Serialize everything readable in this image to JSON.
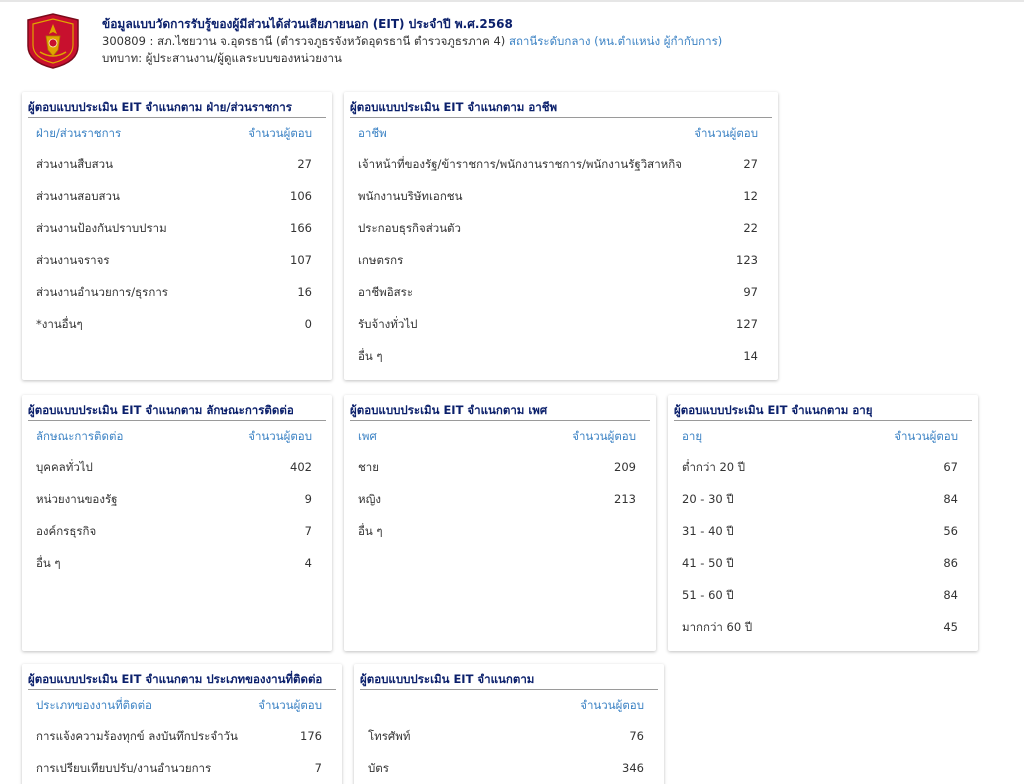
{
  "header": {
    "title": "ข้อมูลแบบวัดการรับรู้ของผู้มีส่วนได้ส่วนเสียภายนอก (EIT) ประจำปี พ.ศ.2568",
    "unit": "300809 : สภ.ไชยวาน จ.อุดรธานี (ตำรวจภูธรจังหวัดอุดรธานี ตำรวจภูธรภาค 4)",
    "unit_level": "สถานีระดับกลาง (หน.ตำแหน่ง ผู้กำกับการ)",
    "role": "บทบาท: ผู้ประสานงาน/ผู้ดูแลระบบของหน่วยงาน"
  },
  "colors": {
    "title": "#0a1f6b",
    "accent": "#3b82c4",
    "logo_red": "#c8102e",
    "logo_gold": "#e0a400"
  },
  "cards": {
    "division": {
      "title": "ผู้ตอบแบบประเมิน EIT จำแนกตาม ฝ่าย/ส่วนราชการ",
      "col_label": "ฝ่าย/ส่วนราชการ",
      "col_value": "จำนวนผู้ตอบ",
      "rows": [
        {
          "label": "ส่วนงานสืบสวน",
          "value": "27"
        },
        {
          "label": "ส่วนงานสอบสวน",
          "value": "106"
        },
        {
          "label": "ส่วนงานป้องกันปราบปราม",
          "value": "166"
        },
        {
          "label": "ส่วนงานจราจร",
          "value": "107"
        },
        {
          "label": "ส่วนงานอำนวยการ/ธุรการ",
          "value": "16"
        },
        {
          "label": "*งานอื่นๆ",
          "value": "0"
        }
      ]
    },
    "occupation": {
      "title": "ผู้ตอบแบบประเมิน EIT จำแนกตาม อาชีพ",
      "col_label": "อาชีพ",
      "col_value": "จำนวนผู้ตอบ",
      "rows": [
        {
          "label": "เจ้าหน้าที่ของรัฐ/ข้าราชการ/พนักงานราชการ/พนักงานรัฐวิสาหกิจ",
          "value": "27"
        },
        {
          "label": "พนักงานบริษัทเอกชน",
          "value": "12"
        },
        {
          "label": "ประกอบธุรกิจส่วนตัว",
          "value": "22"
        },
        {
          "label": "เกษตรกร",
          "value": "123"
        },
        {
          "label": "อาชีพอิสระ",
          "value": "97"
        },
        {
          "label": "รับจ้างทั่วไป",
          "value": "127"
        },
        {
          "label": "อื่น ๆ",
          "value": "14"
        }
      ]
    },
    "contact": {
      "title": "ผู้ตอบแบบประเมิน EIT จำแนกตาม ลักษณะการติดต่อ",
      "col_label": "ลักษณะการติดต่อ",
      "col_value": "จำนวนผู้ตอบ",
      "rows": [
        {
          "label": "บุคคลทั่วไป",
          "value": "402"
        },
        {
          "label": "หน่วยงานของรัฐ",
          "value": "9"
        },
        {
          "label": "องค์กรธุรกิจ",
          "value": "7"
        },
        {
          "label": "อื่น ๆ",
          "value": "4"
        }
      ]
    },
    "gender": {
      "title": "ผู้ตอบแบบประเมิน EIT จำแนกตาม เพศ",
      "col_label": "เพศ",
      "col_value": "จำนวนผู้ตอบ",
      "rows": [
        {
          "label": "ชาย",
          "value": "209"
        },
        {
          "label": "หญิง",
          "value": "213"
        },
        {
          "label": "อื่น ๆ",
          "value": ""
        }
      ]
    },
    "age": {
      "title": "ผู้ตอบแบบประเมิน EIT จำแนกตาม อายุ",
      "col_label": "อายุ",
      "col_value": "จำนวนผู้ตอบ",
      "rows": [
        {
          "label": "ต่ำกว่า 20 ปี",
          "value": "67"
        },
        {
          "label": "20 - 30 ปี",
          "value": "84"
        },
        {
          "label": "31 - 40 ปี",
          "value": "56"
        },
        {
          "label": "41 - 50 ปี",
          "value": "86"
        },
        {
          "label": "51 - 60 ปี",
          "value": "84"
        },
        {
          "label": "มากกว่า 60 ปี",
          "value": "45"
        }
      ]
    },
    "work_type": {
      "title": "ผู้ตอบแบบประเมิน EIT จำแนกตาม ประเภทของงานที่ติดต่อ",
      "col_label": "ประเภทของงานที่ติดต่อ",
      "col_value": "จำนวนผู้ตอบ",
      "rows": [
        {
          "label": "การแจ้งความร้องทุกข์ ลงบันทึกประจำวัน",
          "value": "176"
        },
        {
          "label": "การเปรียบเทียบปรับ/งานอำนวยการ",
          "value": "7"
        }
      ]
    },
    "channel": {
      "title": "ผู้ตอบแบบประเมิน EIT จำแนกตาม",
      "col_label": "",
      "col_value": "จำนวนผู้ตอบ",
      "rows": [
        {
          "label": "โทรศัพท์",
          "value": "76"
        },
        {
          "label": "บัตร",
          "value": "346"
        }
      ]
    }
  }
}
